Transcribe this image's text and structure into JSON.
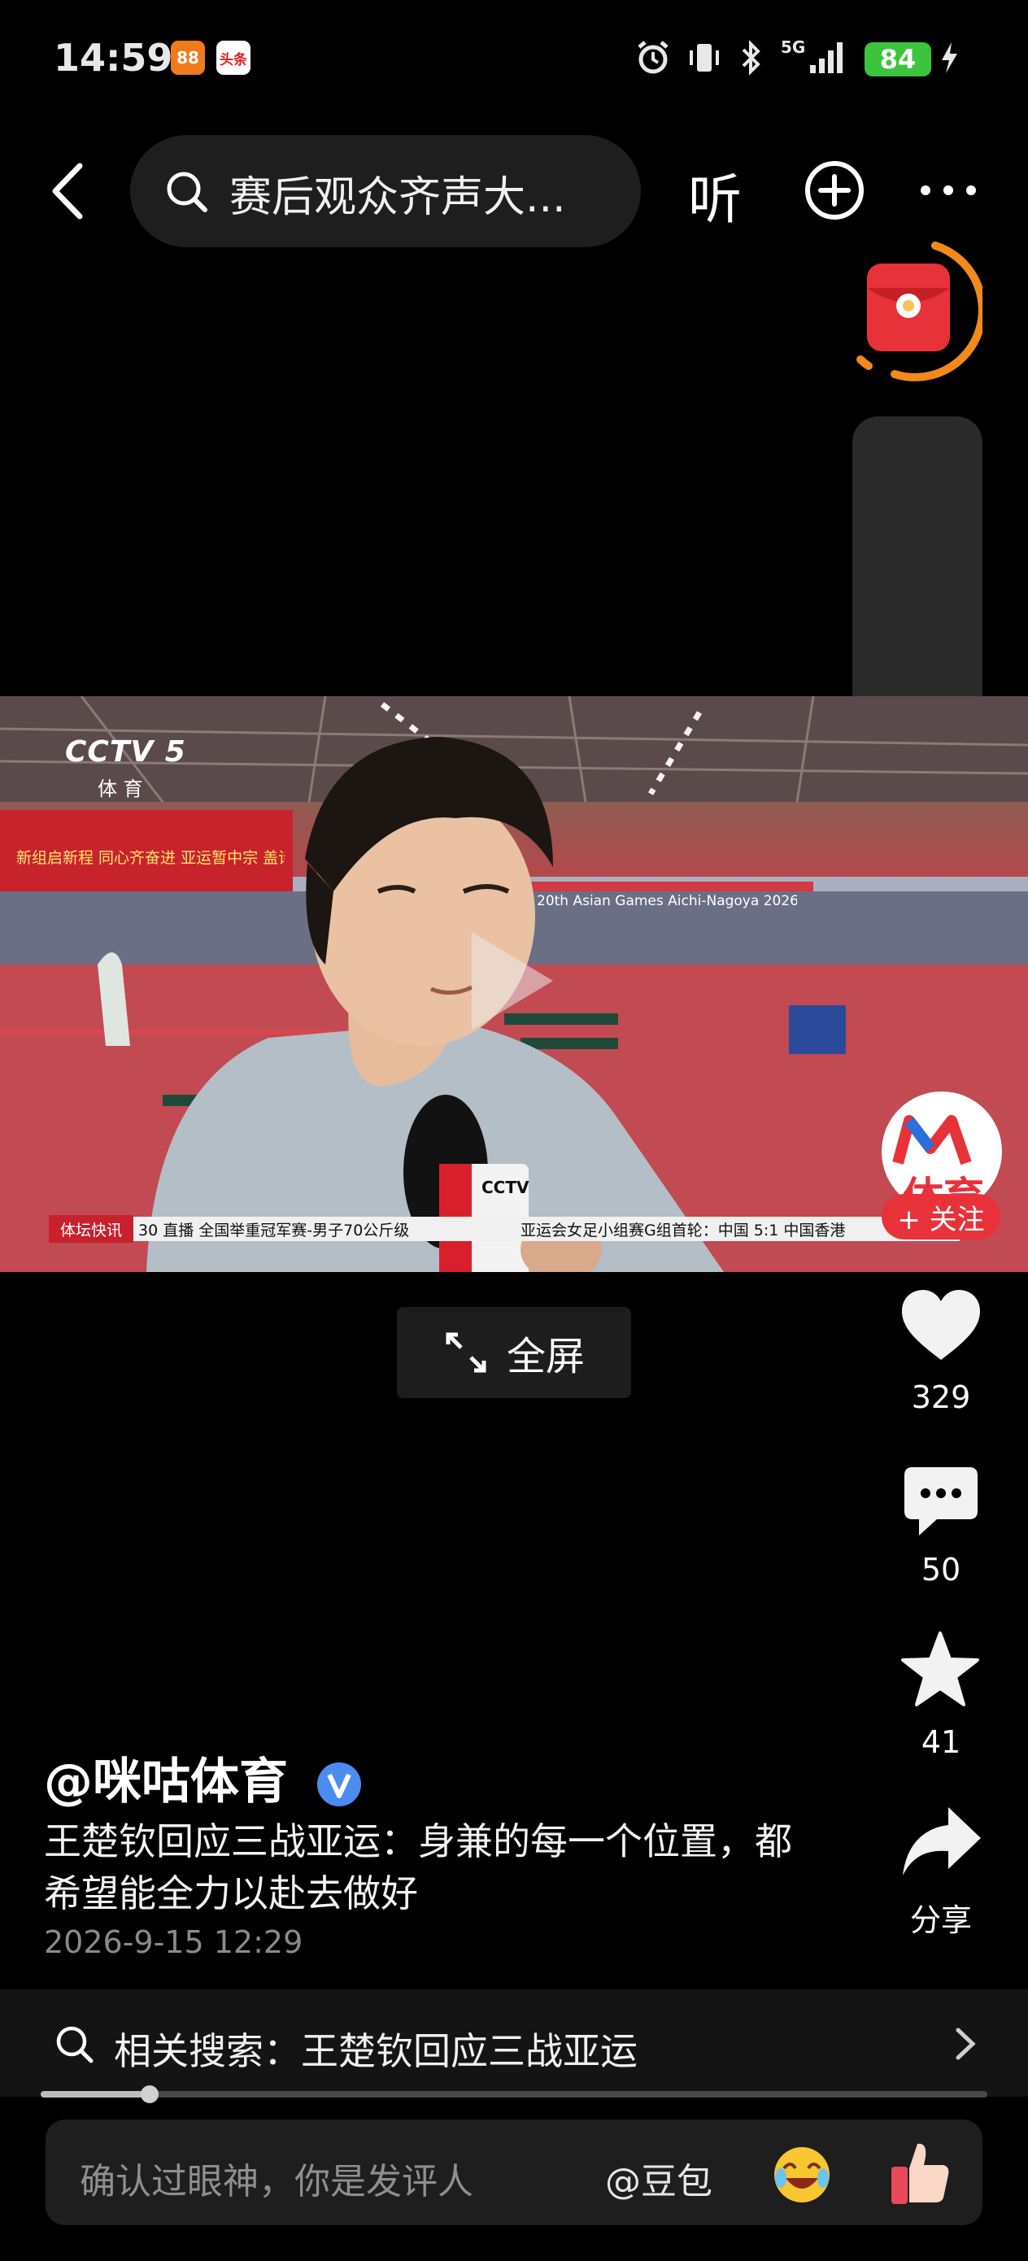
{
  "status_bar": {
    "time": "14:59",
    "app_badges": [
      "88",
      "头条"
    ],
    "network": "5G",
    "battery": "84"
  },
  "top_bar": {
    "search_text": "赛后观众齐声大...",
    "listen_label": "听"
  },
  "video": {
    "channel_logo": "CCTV 5",
    "channel_sub": "体 育",
    "banner_text": "新组启新程 同心齐奋进 亚运暂中宗 盖诗地方家",
    "event_text": "20th Asian Games Aichi-Nagoya 2026",
    "mic_logo": "CCTV",
    "ticker_tag": "体坛快讯",
    "ticker_left": "30 直播 全国举重冠军赛-男子70公斤级",
    "ticker_right": "亚运会女足小组赛G组首轮：中国 5:1 中国香港",
    "fullscreen_label": "全屏"
  },
  "right_rail": {
    "account_brand": "体育",
    "follow_label": "+ 关注",
    "like_count": "329",
    "comment_count": "50",
    "favorite_count": "41",
    "share_label": "分享"
  },
  "post": {
    "author": "@咪咕体育",
    "title": "王楚钦回应三战亚运：身兼的每一个位置，都希望能全力以赴去做好",
    "timestamp": "2026-9-15 12:29"
  },
  "related_search": {
    "label": "相关搜索：王楚钦回应三战亚运"
  },
  "playback": {
    "progress": 0.115
  },
  "comment_bar": {
    "placeholder": "确认过眼神，你是发评人",
    "mention": "@豆包"
  },
  "colors": {
    "background": "#000000",
    "follow_red": "#e8323a",
    "battery_green": "#3cc43c",
    "verified_blue": "#4a8cf0",
    "redpacket_orange": "#f08a1a"
  }
}
